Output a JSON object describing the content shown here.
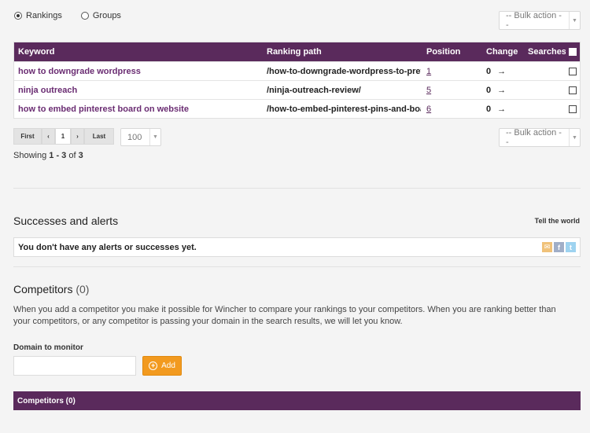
{
  "view_toggle": {
    "rankings_label": "Rankings",
    "groups_label": "Groups",
    "selected": "rankings"
  },
  "bulk_action": {
    "label": "-- Bulk action --"
  },
  "table": {
    "headers": {
      "keyword": "Keyword",
      "ranking_path": "Ranking path",
      "position": "Position",
      "change": "Change",
      "searches": "Searches"
    },
    "rows": [
      {
        "keyword": "how to downgrade wordpress",
        "path": "/how-to-downgrade-wordpress-to-previ...",
        "position": "1",
        "change": "0",
        "arrow": "→"
      },
      {
        "keyword": "ninja outreach",
        "path": "/ninja-outreach-review/",
        "position": "5",
        "change": "0",
        "arrow": "→"
      },
      {
        "keyword": "how to embed pinterest board on website",
        "path": "/how-to-embed-pinterest-pins-and-boar...",
        "position": "6",
        "change": "0",
        "arrow": "→"
      }
    ]
  },
  "pager": {
    "first": "First",
    "prev": "‹",
    "current": "1",
    "next": "›",
    "last": "Last",
    "per_page": "100"
  },
  "showing": {
    "prefix": "Showing ",
    "from": "1",
    "dash": " - ",
    "to": "3",
    "of": " of ",
    "total": "3"
  },
  "alerts": {
    "title": "Successes and alerts",
    "tell_world": "Tell the world",
    "empty_message": "You don't have any alerts or successes yet."
  },
  "competitors": {
    "title": "Competitors",
    "count": "(0)",
    "description": "When you add a competitor you make it possible for Wincher to compare your rankings to your competitors. When you are ranking better than your competitors, or any competitor is passing your domain in the search results, we will let you know.",
    "domain_label": "Domain to monitor",
    "domain_value": "",
    "add_label": "Add",
    "bar_label": "Competitors (0)"
  },
  "icons": {
    "mail": "mail-icon",
    "facebook": "facebook-icon",
    "twitter": "twitter-icon"
  },
  "colors": {
    "header_purple": "#5a2a5c",
    "link_purple": "#6a2c72",
    "add_orange": "#f29a1f"
  }
}
